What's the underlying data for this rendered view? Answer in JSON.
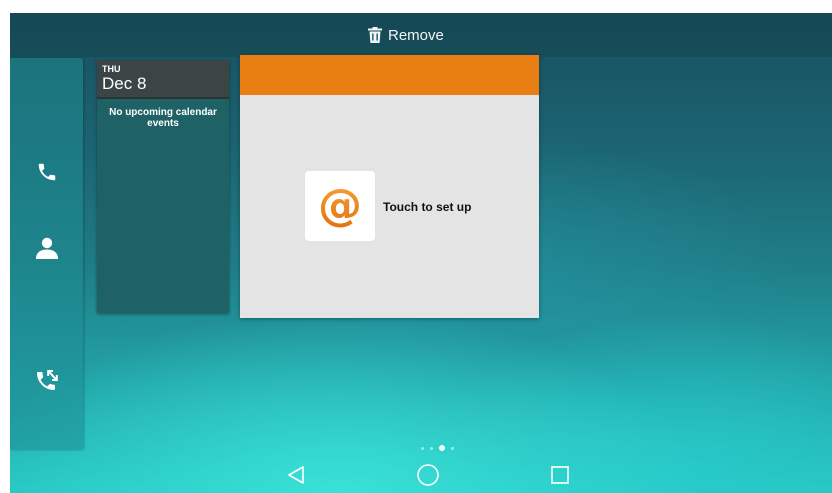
{
  "topbar": {
    "remove_label": "Remove",
    "remove_icon": "trash-icon"
  },
  "dock": {
    "items": [
      {
        "name": "phone",
        "icon": "phone-icon"
      },
      {
        "name": "contacts",
        "icon": "person-icon"
      },
      {
        "name": "call-history",
        "icon": "phone-arrows-icon"
      }
    ]
  },
  "calendar_widget": {
    "day": "THU",
    "date": "Dec 8",
    "empty_message": "No upcoming calendar events"
  },
  "email_widget": {
    "icon": "at-sign-icon",
    "label": "Touch to set up",
    "header_color": "#e97e12",
    "at_symbol": "@"
  },
  "page_indicator": {
    "count": 4,
    "active_index": 2
  },
  "navbar": {
    "back_icon": "back-triangle-icon",
    "home_icon": "home-circle-icon",
    "recents_icon": "recents-square-icon"
  },
  "colors": {
    "accent_orange": "#e97e12",
    "teal": "#22a2a6",
    "calendar_bg": "#1f6266"
  }
}
